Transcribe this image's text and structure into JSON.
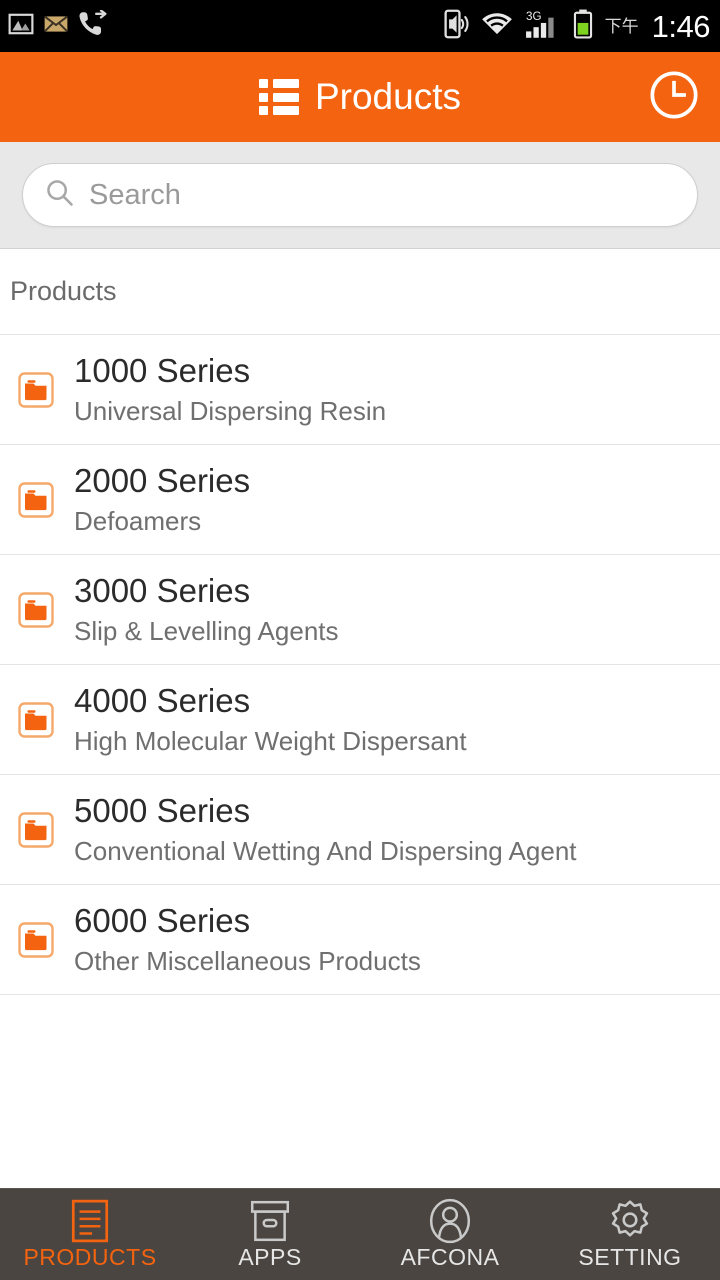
{
  "status_bar": {
    "time": "1:46",
    "ampm": "下午",
    "left_icons": [
      "image-icon",
      "email-icon",
      "call-forward-icon"
    ],
    "right_icons": [
      "vibrate-icon",
      "wifi-icon",
      "signal-3g-icon",
      "battery-icon"
    ],
    "network_label": "3G",
    "background": "#000000"
  },
  "header": {
    "title": "Products",
    "menu_icon": "list-icon",
    "action_icon": "clock-icon",
    "background": "#F4630F"
  },
  "search": {
    "placeholder": "Search",
    "value": "",
    "icon": "search-icon"
  },
  "section": {
    "title": "Products"
  },
  "products": [
    {
      "title": "1000 Series",
      "subtitle": "Universal Dispersing Resin",
      "icon": "folder-icon"
    },
    {
      "title": "2000 Series",
      "subtitle": "Defoamers",
      "icon": "folder-icon"
    },
    {
      "title": "3000 Series",
      "subtitle": "Slip & Levelling Agents",
      "icon": "folder-icon"
    },
    {
      "title": "4000 Series",
      "subtitle": "High Molecular Weight Dispersant",
      "icon": "folder-icon"
    },
    {
      "title": "5000 Series",
      "subtitle": "Conventional Wetting And Dispersing Agent",
      "icon": "folder-icon"
    },
    {
      "title": "6000 Series",
      "subtitle": "Other Miscellaneous Products",
      "icon": "folder-icon"
    }
  ],
  "bottom_nav": {
    "background": "#4A4540",
    "active_color": "#F4630F",
    "items": [
      {
        "label": "PRODUCTS",
        "icon": "document-icon",
        "active": true
      },
      {
        "label": "APPS",
        "icon": "box-icon",
        "active": false
      },
      {
        "label": "AFCONA",
        "icon": "person-icon",
        "active": false
      },
      {
        "label": "SETTING",
        "icon": "gear-icon",
        "active": false
      }
    ]
  },
  "colors": {
    "accent": "#F4630F",
    "nav_background": "#4A4540",
    "search_background": "#e8e8e8",
    "divider": "#e4e4e4"
  }
}
